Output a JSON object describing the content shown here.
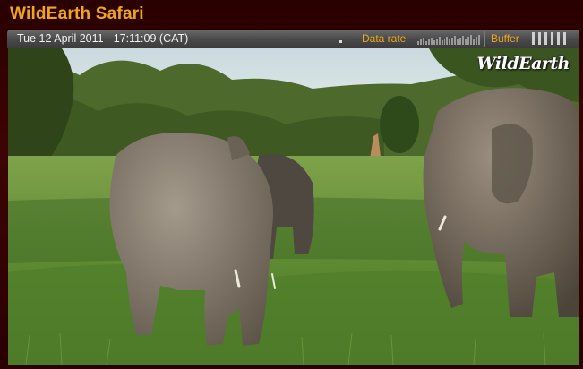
{
  "window": {
    "title": "WildEarth Safari"
  },
  "status_bar": {
    "timestamp": "Tue 12 April 2011 - 17:11:09 (CAT)",
    "data_rate_label": "Data rate",
    "buffer_label": "Buffer"
  },
  "video": {
    "watermark": "WildEarth",
    "scene": "elephants-grazing"
  },
  "colors": {
    "accent": "#f0a51e",
    "background": "#3a0000",
    "status_bar": "#4a4a4a"
  }
}
